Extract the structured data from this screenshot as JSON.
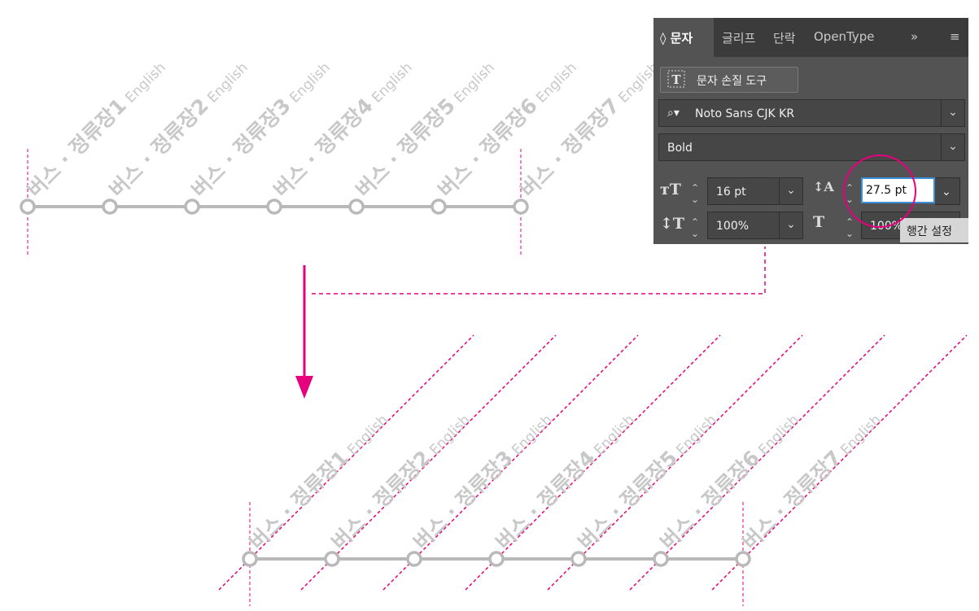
{
  "diagram": {
    "stop_labels": [
      {
        "bold": "버스 · 정류장1",
        "light": "English"
      },
      {
        "bold": "버스 · 정류장2",
        "light": "English"
      },
      {
        "bold": "버스 · 정류장3",
        "light": "English"
      },
      {
        "bold": "버스 · 정류장4",
        "light": "English"
      },
      {
        "bold": "버스 · 정류장5",
        "light": "English"
      },
      {
        "bold": "버스 · 정류장6",
        "light": "English"
      },
      {
        "bold": "버스 · 정류장7",
        "light": "English"
      }
    ],
    "colors": {
      "accent": "#e6007e",
      "route": "#b9b9b9",
      "label": "#c8c8c8",
      "panel_bg": "#535353"
    }
  },
  "panel": {
    "tabs": [
      "◊ 문자",
      "글리프",
      "단락",
      "OpenType",
      "»",
      "≡"
    ],
    "touch_tool_label": "문자 손질 도구",
    "font_family": "Noto Sans CJK KR",
    "font_style": "Bold",
    "font_size": "16 pt",
    "leading": "27.5 pt",
    "vertical_scale": "100%",
    "horizontal_scale": "100%",
    "tooltip": "행간 설정"
  }
}
